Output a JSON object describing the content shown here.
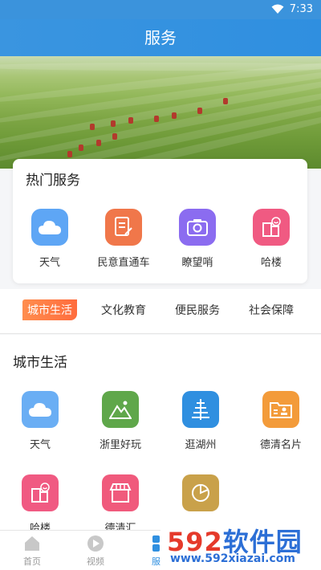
{
  "status_bar": {
    "time": "7:33"
  },
  "title_bar": {
    "title": "服务"
  },
  "hot_services": {
    "heading": "热门服务",
    "items": [
      {
        "label": "天气",
        "icon": "cloud-icon",
        "color": "#5ea6f5"
      },
      {
        "label": "民意直通车",
        "icon": "document-edit-icon",
        "color": "#f0774a"
      },
      {
        "label": "瞭望哨",
        "icon": "camera-icon",
        "color": "#8b6cf0"
      },
      {
        "label": "哈楼",
        "icon": "smile-building-icon",
        "color": "#f05a82"
      }
    ]
  },
  "category_tabs": {
    "items": [
      {
        "label": "城市生活",
        "active": true
      },
      {
        "label": "文化教育",
        "active": false
      },
      {
        "label": "便民服务",
        "active": false
      },
      {
        "label": "社会保障",
        "active": false
      }
    ]
  },
  "city_life": {
    "heading": "城市生活",
    "items": [
      {
        "label": "天气",
        "icon": "cloud-icon",
        "color": "#6aaef4"
      },
      {
        "label": "浙里好玩",
        "icon": "mountain-icon",
        "color": "#5fa74a"
      },
      {
        "label": "逛湖州",
        "icon": "tower-icon",
        "color": "#2f8fe0"
      },
      {
        "label": "德清名片",
        "icon": "id-card-icon",
        "color": "#f39b3a"
      },
      {
        "label": "哈楼",
        "icon": "smile-building-icon",
        "color": "#f05a82"
      },
      {
        "label": "德清汇",
        "icon": "shop-icon",
        "color": "#f05a7c"
      },
      {
        "label": "",
        "icon": "pie-chart-icon",
        "color": "#c9a14a"
      }
    ]
  },
  "bottom_nav": {
    "items": [
      {
        "label": "首页",
        "icon": "home-icon",
        "active": false
      },
      {
        "label": "视频",
        "icon": "play-icon",
        "active": false
      },
      {
        "label": "服务",
        "icon": "grid-icon",
        "active": true
      }
    ]
  },
  "watermark": {
    "brand_number": "592",
    "brand_text": "软件园",
    "url": "www.592xiazai.com"
  }
}
